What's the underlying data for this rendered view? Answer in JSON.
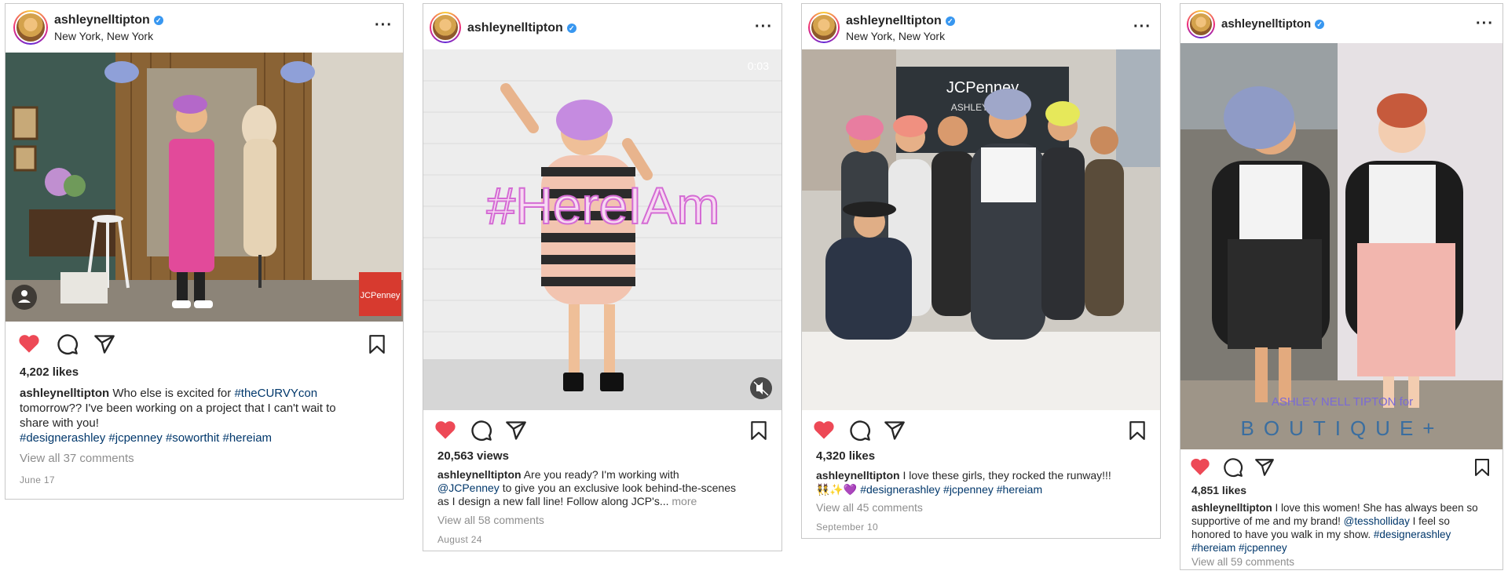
{
  "posts": [
    {
      "username": "ashleynelltipton",
      "location": "New York, New York",
      "photo_brand": "JCPenney",
      "likes": "4,202 likes",
      "caption_user": "ashleynelltipton",
      "caption_line1": "Who else is excited for",
      "caption_tag1": "#theCURVYcon",
      "caption_line2": "tomorrow?? I've been working on a project that I can't wait to",
      "caption_line3": "share with you!",
      "caption_tags": "#designerashley #jcpenney #soworthit #hereiam",
      "comments": "View all 37 comments",
      "date": "June 17"
    },
    {
      "username": "ashleynelltipton",
      "video_time": "0:03",
      "overlay_text": "#HereIAm",
      "likes": "20,563 views",
      "caption_user": "ashleynelltipton",
      "caption_line1": "Are you ready? I'm working with",
      "caption_mention": "@JCPenney",
      "caption_line2": "to give you an exclusive look behind-the-scenes",
      "caption_line3": "as I design a new fall line! Follow along JCP's...",
      "caption_more": "more",
      "comments": "View all 58 comments",
      "date": "August 24"
    },
    {
      "username": "ashleynelltipton",
      "location": "New York, New York",
      "backdrop_brand": "JCPenney",
      "backdrop_name": "ASHLEY NELL T",
      "likes": "4,320 likes",
      "caption_user": "ashleynelltipton",
      "caption_line1": "I love these girls, they rocked the runway!!!",
      "caption_emoji": "👯✨💜",
      "caption_tags": "#designerashley #jcpenney #hereiam",
      "comments": "View all 45 comments",
      "date": "September 10"
    },
    {
      "username": "ashleynelltipton",
      "overlay_line1": "ASHLEY NELL TIPTON for",
      "overlay_line2": "BOUTIQUE+",
      "likes": "4,851 likes",
      "caption_user": "ashleynelltipton",
      "caption_line1": "I love this women! She has always been so",
      "caption_line2": "supportive of me and my brand!",
      "caption_mention": "@tessholliday",
      "caption_line2b": "I feel so",
      "caption_line3": "honored to have you walk in my show.",
      "caption_tag3": "#designerashley",
      "caption_tags": "#hereiam #jcpenney",
      "comments": "View all 59 comments"
    }
  ],
  "colors": {
    "heart": "#ed4956",
    "link": "#00376b",
    "muted": "#8e8e8e",
    "verified": "#3897f0"
  },
  "icons": [
    "heart-icon",
    "comment-icon",
    "share-icon",
    "bookmark-icon",
    "more-icon",
    "verified-icon",
    "mute-icon",
    "user-tag-icon"
  ]
}
